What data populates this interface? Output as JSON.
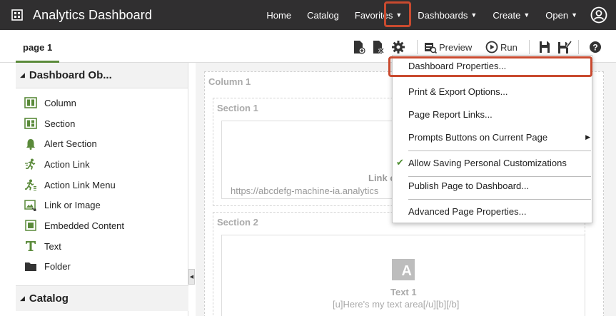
{
  "header": {
    "title": "Analytics Dashboard",
    "nav": [
      {
        "label": "Home",
        "dropdown": false
      },
      {
        "label": "Catalog",
        "dropdown": false
      },
      {
        "label": "Favorites",
        "dropdown": true
      },
      {
        "label": "Dashboards",
        "dropdown": true
      },
      {
        "label": "Create",
        "dropdown": true
      },
      {
        "label": "Open",
        "dropdown": true
      }
    ]
  },
  "toolbar": {
    "page_tab": "page 1",
    "preview_label": "Preview",
    "run_label": "Run"
  },
  "left_panel": {
    "header": "Dashboard Ob...",
    "items": [
      {
        "label": "Column",
        "icon": "column-icon"
      },
      {
        "label": "Section",
        "icon": "section-icon"
      },
      {
        "label": "Alert Section",
        "icon": "bell-icon"
      },
      {
        "label": "Action Link",
        "icon": "runner-icon"
      },
      {
        "label": "Action Link Menu",
        "icon": "runner-menu-icon"
      },
      {
        "label": "Link or Image",
        "icon": "image-link-icon"
      },
      {
        "label": "Embedded Content",
        "icon": "embedded-icon"
      },
      {
        "label": "Text",
        "icon": "text-icon"
      },
      {
        "label": "Folder",
        "icon": "folder-icon"
      }
    ],
    "catalog_header": "Catalog"
  },
  "canvas": {
    "column_label": "Column 1",
    "section1_label": "Section 1",
    "link_title": "Link o",
    "link_url": "https://abcdefg-machine-ia.analytics",
    "section2_label": "Section 2",
    "text_icon_letter": "A",
    "text_title": "Text 1",
    "text_body": "[u]Here's my text area[/u][b][/b]"
  },
  "menu": {
    "items": [
      {
        "label": "Dashboard Properties...",
        "checked": false,
        "submenu": false
      },
      {
        "label": "Print & Export Options...",
        "checked": false,
        "submenu": false
      },
      {
        "label": "Page Report Links...",
        "checked": false,
        "submenu": false
      },
      {
        "label": "Prompts Buttons on Current Page",
        "checked": false,
        "submenu": true
      },
      {
        "label": "Allow Saving Personal Customizations",
        "checked": true,
        "submenu": false
      },
      {
        "label": "Publish Page to Dashboard...",
        "checked": false,
        "submenu": false
      },
      {
        "label": "Advanced Page Properties...",
        "checked": false,
        "submenu": false
      }
    ]
  },
  "colors": {
    "header_bg": "#302f30",
    "accent_green": "#5a8a3a",
    "highlight_red": "#c94a2f"
  }
}
